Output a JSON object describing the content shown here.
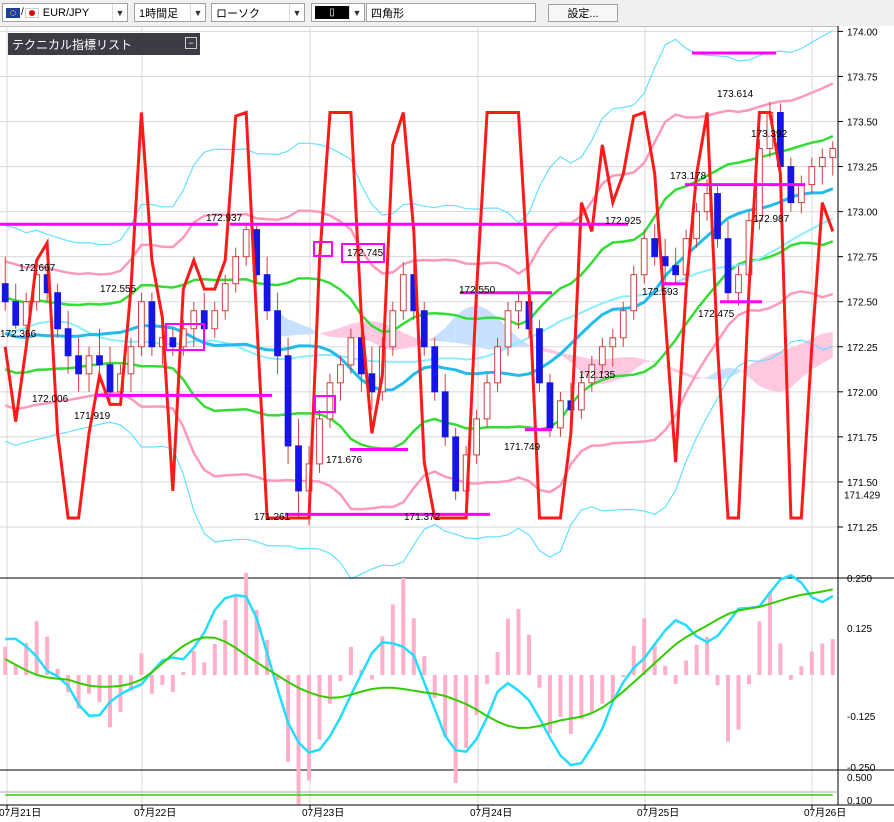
{
  "toolbar": {
    "symbol": "EUR/JPY",
    "timeframe": "1時間足",
    "chart_style": "ローソク",
    "draw_tool_value": "四角形",
    "settings_label": "設定..."
  },
  "indicator_panel": {
    "title": "テクニカル指標リスト"
  },
  "colors": {
    "bull": "#ffffff",
    "bear": "#1515e6",
    "wick": "#d04040",
    "bb_outer": "#66e0ff",
    "bb_mid": "#ff99bb",
    "bb_inner": "#33dd33",
    "ma_fast": "#22bbee",
    "ma_slow": "#88eeff",
    "rsi_line": "#ff1a1a",
    "cloud_bull": "#c8e0ff",
    "cloud_bear": "#ffc8e0",
    "level": "#ff00ff",
    "macd_hist": "#ffb0c8",
    "osc_cyan": "#22ddff",
    "osc_green": "#33cc00"
  },
  "chart_data": {
    "type": "candlestick",
    "pair": "EUR/JPY",
    "timeframe": "1時間足",
    "x_labels": [
      "07月21日",
      "07月22日",
      "07月23日",
      "07月24日",
      "07月25日",
      "07月26日"
    ],
    "y_ticks": [
      "174.00",
      "173.75",
      "173.50",
      "173.25",
      "173.00",
      "172.75",
      "172.50",
      "172.25",
      "172.00",
      "171.75",
      "171.50",
      "171.25"
    ],
    "current_price": "171.429",
    "price_annotations": [
      "172.667",
      "172.555",
      "172.366",
      "172.006",
      "171.919",
      "172.937",
      "172.745",
      "171.676",
      "171.261",
      "171.372",
      "172.550",
      "171.749",
      "172.135",
      "172.925",
      "172.593",
      "173.178",
      "173.614",
      "173.392",
      "172.987",
      "172.475"
    ],
    "ylim": [
      171.15,
      174.03
    ],
    "candles": [
      [
        172.6,
        172.75,
        172.45,
        172.5
      ],
      [
        172.5,
        172.6,
        172.35,
        172.37
      ],
      [
        172.37,
        172.55,
        172.3,
        172.5
      ],
      [
        172.5,
        172.7,
        172.45,
        172.65
      ],
      [
        172.65,
        172.7,
        172.5,
        172.55
      ],
      [
        172.55,
        172.6,
        172.3,
        172.35
      ],
      [
        172.35,
        172.45,
        172.1,
        172.2
      ],
      [
        172.2,
        172.3,
        172.0,
        172.1
      ],
      [
        172.1,
        172.25,
        172.0,
        172.2
      ],
      [
        172.2,
        172.35,
        172.05,
        172.15
      ],
      [
        172.15,
        172.25,
        171.95,
        172.0
      ],
      [
        172.0,
        172.15,
        171.92,
        172.1
      ],
      [
        172.1,
        172.3,
        172.0,
        172.25
      ],
      [
        172.25,
        172.55,
        172.2,
        172.5
      ],
      [
        172.5,
        172.55,
        172.2,
        172.25
      ],
      [
        172.25,
        172.4,
        172.15,
        172.3
      ],
      [
        172.3,
        172.35,
        172.2,
        172.25
      ],
      [
        172.25,
        172.4,
        172.2,
        172.35
      ],
      [
        172.35,
        172.5,
        172.25,
        172.45
      ],
      [
        172.45,
        172.55,
        172.3,
        172.35
      ],
      [
        172.35,
        172.5,
        172.3,
        172.45
      ],
      [
        172.45,
        172.65,
        172.4,
        172.6
      ],
      [
        172.6,
        172.8,
        172.55,
        172.75
      ],
      [
        172.75,
        172.94,
        172.7,
        172.9
      ],
      [
        172.9,
        172.92,
        172.6,
        172.65
      ],
      [
        172.65,
        172.75,
        172.4,
        172.45
      ],
      [
        172.45,
        172.55,
        172.1,
        172.2
      ],
      [
        172.2,
        172.3,
        171.6,
        171.7
      ],
      [
        171.7,
        171.85,
        171.3,
        171.45
      ],
      [
        171.45,
        171.7,
        171.26,
        171.6
      ],
      [
        171.6,
        171.9,
        171.55,
        171.85
      ],
      [
        171.85,
        172.1,
        171.8,
        172.05
      ],
      [
        172.05,
        172.2,
        171.95,
        172.15
      ],
      [
        172.15,
        172.35,
        172.1,
        172.3
      ],
      [
        172.3,
        172.4,
        172.0,
        172.1
      ],
      [
        172.1,
        172.25,
        171.9,
        172.0
      ],
      [
        172.0,
        172.3,
        171.95,
        172.25
      ],
      [
        172.25,
        172.5,
        172.2,
        172.45
      ],
      [
        172.45,
        172.72,
        172.4,
        172.65
      ],
      [
        172.65,
        172.75,
        172.4,
        172.45
      ],
      [
        172.45,
        172.5,
        172.2,
        172.25
      ],
      [
        172.25,
        172.3,
        171.95,
        172.0
      ],
      [
        172.0,
        172.1,
        171.7,
        171.75
      ],
      [
        171.75,
        171.8,
        171.4,
        171.45
      ],
      [
        171.45,
        171.7,
        171.37,
        171.65
      ],
      [
        171.65,
        171.9,
        171.6,
        171.85
      ],
      [
        171.85,
        172.1,
        171.8,
        172.05
      ],
      [
        172.05,
        172.3,
        172.0,
        172.25
      ],
      [
        172.25,
        172.5,
        172.2,
        172.45
      ],
      [
        172.45,
        172.55,
        172.35,
        172.5
      ],
      [
        172.5,
        172.55,
        172.3,
        172.35
      ],
      [
        172.35,
        172.4,
        172.0,
        172.05
      ],
      [
        172.05,
        172.1,
        171.75,
        171.8
      ],
      [
        171.8,
        172.0,
        171.75,
        171.95
      ],
      [
        171.95,
        172.05,
        171.85,
        171.9
      ],
      [
        171.9,
        172.1,
        171.85,
        172.05
      ],
      [
        172.05,
        172.2,
        172.0,
        172.15
      ],
      [
        172.15,
        172.3,
        172.1,
        172.25
      ],
      [
        172.25,
        172.35,
        172.14,
        172.3
      ],
      [
        172.3,
        172.5,
        172.25,
        172.45
      ],
      [
        172.45,
        172.7,
        172.4,
        172.65
      ],
      [
        172.65,
        172.9,
        172.6,
        172.85
      ],
      [
        172.85,
        172.93,
        172.7,
        172.75
      ],
      [
        172.75,
        172.85,
        172.6,
        172.7
      ],
      [
        172.7,
        172.8,
        172.59,
        172.65
      ],
      [
        172.65,
        172.9,
        172.6,
        172.85
      ],
      [
        172.85,
        173.05,
        172.8,
        173.0
      ],
      [
        173.0,
        173.18,
        172.95,
        173.1
      ],
      [
        173.1,
        173.15,
        172.8,
        172.85
      ],
      [
        172.85,
        172.95,
        172.5,
        172.55
      ],
      [
        172.55,
        172.7,
        172.48,
        172.65
      ],
      [
        172.65,
        173.0,
        172.6,
        172.95
      ],
      [
        172.95,
        173.4,
        172.9,
        173.35
      ],
      [
        173.35,
        173.61,
        173.3,
        173.55
      ],
      [
        173.55,
        173.6,
        173.2,
        173.25
      ],
      [
        173.25,
        173.3,
        173.0,
        173.05
      ],
      [
        173.05,
        173.2,
        172.99,
        173.15
      ],
      [
        173.15,
        173.3,
        173.1,
        173.25
      ],
      [
        173.25,
        173.35,
        173.15,
        173.3
      ],
      [
        173.3,
        173.39,
        173.2,
        173.35
      ]
    ]
  }
}
